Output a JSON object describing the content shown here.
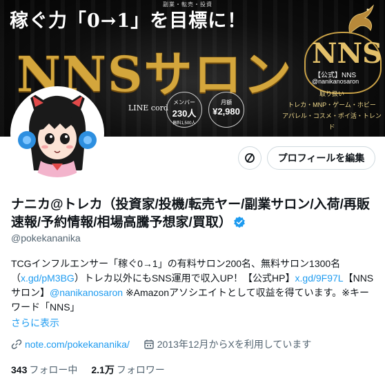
{
  "banner": {
    "tagline": "稼ぐ力「0→1」を目標に！",
    "subtag": "副業・転売・投資",
    "title": "NNSサロン",
    "logo_text": "NNS",
    "logo_sub": "【公式】NNS",
    "logo_handle": "@nanikanosaron",
    "badge_line_text": "LINE cord",
    "badge_members_small": "メンバー",
    "badge_members_big": "230人",
    "badge_members_tiny": "無料1,500人",
    "badge_price_small": "月額",
    "badge_price_big": "¥2,980",
    "handles_line1": "取り扱い",
    "handles_line2": "トレカ・MNP・ゲーム・ホビー",
    "handles_line3": "アパレル・コスメ・ポイ活・トレンド"
  },
  "actions": {
    "edit_profile_label": "プロフィールを編集"
  },
  "profile": {
    "display_name": "ナニカ@トレカ（投資家/投機/転売ヤー/副業サロン/入荷/再販速報/予約情報/相場高騰予想家/買取）",
    "handle": "@pokekananika",
    "bio": {
      "part1": "TCGインフルエンサー「稼ぐ0→1」の有料サロン200名、無料サロン1300名（",
      "link1": "x.gd/pM3BG",
      "part2": "）トレカ以外にもSNS運用で収入UP！【公式HP】",
      "link2": "x.gd/9F97L",
      "part3": "【NNSサロン】",
      "mention": "@nanikanosaron",
      "part4": " ※Amazonアソシエイトとして収益を得ています。※キーワード「NNS」"
    },
    "show_more": "さらに表示",
    "website": "note.com/pokekananika/",
    "joined": "2013年12月からXを利用しています",
    "following_count": "343",
    "following_label": "フォロー中",
    "followers_count": "2.1万",
    "followers_label": "フォロワー"
  },
  "colors": {
    "accent": "#1d9bf0",
    "gold": "#d4a63c",
    "muted_text": "#536471",
    "border": "#cfd9de"
  }
}
